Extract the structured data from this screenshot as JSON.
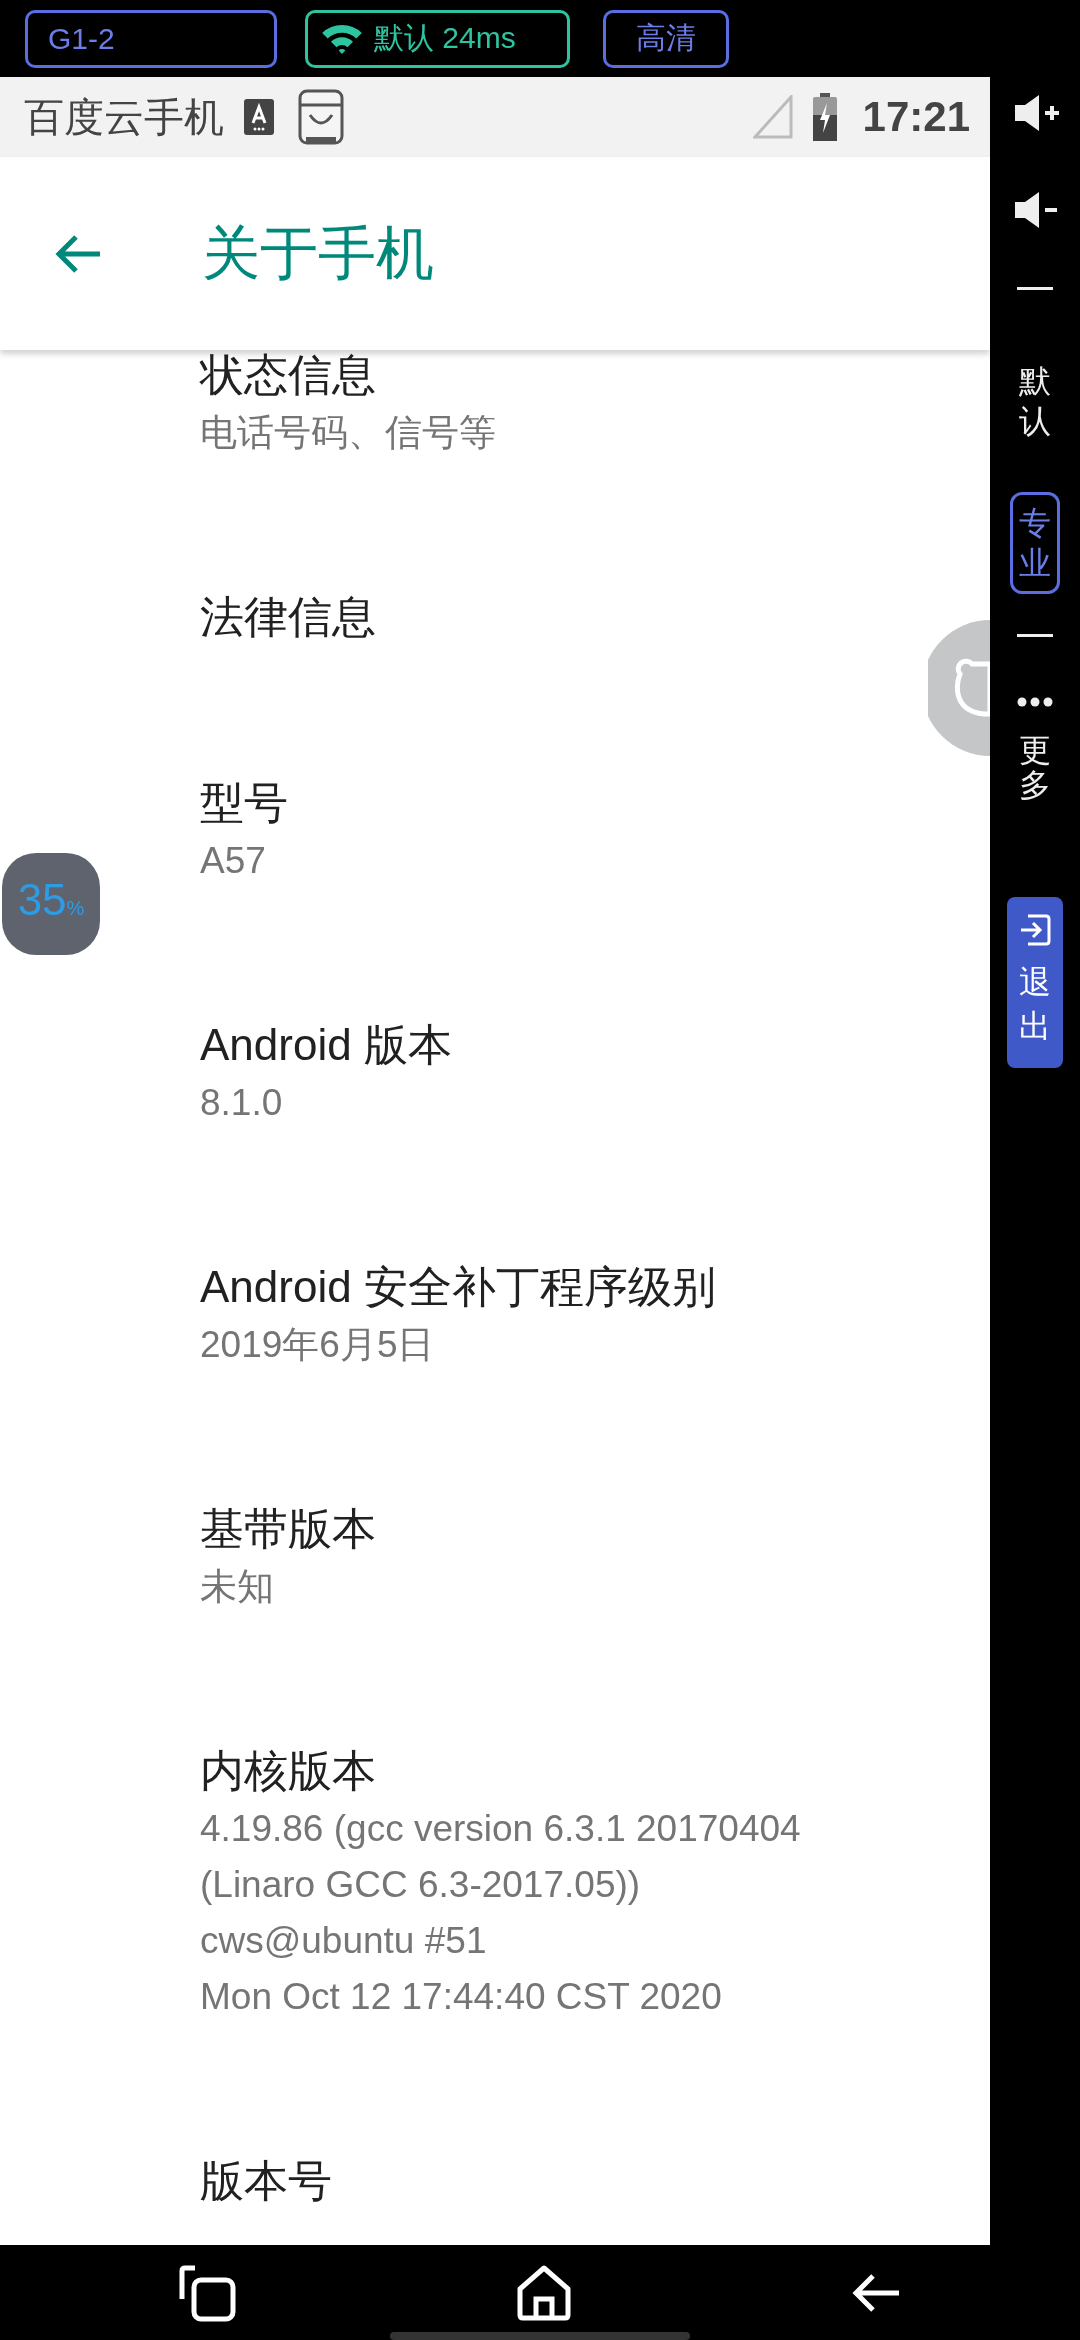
{
  "top_bar": {
    "device": "G1-2",
    "network": "默认 24ms",
    "quality": "高清"
  },
  "status_bar": {
    "app_name": "百度云手机",
    "time": "17:21"
  },
  "app_bar": {
    "title": "关于手机"
  },
  "settings": [
    {
      "title": "状态信息",
      "summary": [
        "电话号码、信号等"
      ]
    },
    {
      "title": "法律信息"
    },
    {
      "title": "型号",
      "summary": [
        "A57"
      ]
    },
    {
      "title": "Android 版本",
      "summary": [
        "8.1.0"
      ]
    },
    {
      "title": "Android 安全补丁程序级别",
      "summary": [
        "2019年6月5日"
      ]
    },
    {
      "title": "基带版本",
      "summary": [
        "未知"
      ]
    },
    {
      "title": "内核版本",
      "summary": [
        "4.19.86 (gcc version 6.3.1 20170404",
        "(Linaro GCC 6.3-2017.05))",
        "cws@ubuntu #51",
        "Mon Oct 12 17:44:40 CST 2020"
      ]
    },
    {
      "title": "版本号"
    }
  ],
  "float_badge": {
    "value": "35",
    "unit": "%"
  },
  "sidebar": [
    {
      "kind": "volume_up"
    },
    {
      "kind": "volume_down"
    },
    {
      "kind": "divider"
    },
    {
      "kind": "mode",
      "label": "默认",
      "selected": false
    },
    {
      "kind": "mode",
      "label": "专业",
      "selected": true
    },
    {
      "kind": "divider"
    },
    {
      "kind": "more",
      "label": "更多"
    },
    {
      "kind": "exit",
      "label": "退出"
    }
  ]
}
